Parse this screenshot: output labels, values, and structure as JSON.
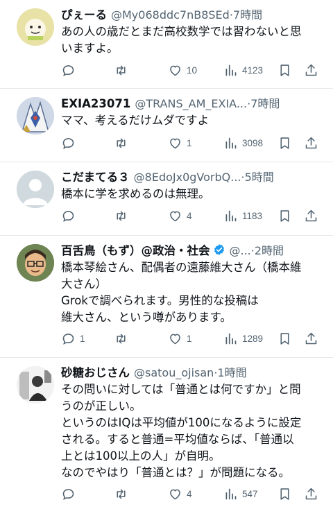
{
  "posts": [
    {
      "name": "ぴぇーる",
      "handle": "@My068ddc7nB8SEd",
      "sep": "·",
      "time": "7時間",
      "lines": [
        "あの人の歳だとまだ高校数学では習わないと思",
        "いますよ。"
      ],
      "replies": "",
      "reposts": "",
      "likes": "10",
      "views": "4123",
      "verified": false
    },
    {
      "name": "EXIA23071",
      "handle": "@TRANS_AM_EXIA...",
      "sep": "·",
      "time": "7時間",
      "lines": [
        "ママ、考えるだけムダですよ"
      ],
      "replies": "",
      "reposts": "",
      "likes": "1",
      "views": "3098",
      "verified": false
    },
    {
      "name": "こだまてる３",
      "handle": "@8EdoJx0gVorbQ...",
      "sep": "·",
      "time": "5時間",
      "lines": [
        "橋本に学を求めるのは無理。"
      ],
      "replies": "",
      "reposts": "",
      "likes": "4",
      "views": "1183",
      "verified": false
    },
    {
      "name": "百舌鳥（もず）@政治・社会",
      "handle": "@...",
      "sep": "·",
      "time": "2時間",
      "lines": [
        "橋本琴絵さん、配偶者の遠藤維大さん（橋本維",
        "大さん）",
        "Grokで調べられます。男性的な投稿は",
        "維大さん、という噂があります。"
      ],
      "replies": "1",
      "reposts": "",
      "likes": "1",
      "views": "1289",
      "verified": true
    },
    {
      "name": "砂糖おじさん",
      "handle": "@satou_ojisan",
      "sep": "·",
      "time": "1時間",
      "lines": [
        "その問いに対しては「普通とは何ですか」と問",
        "うのが正しい。",
        "というのはIQは平均値が100になるように設定",
        "される。すると普通=平均値ならば、「普通以",
        "上とは100以上の人」が自明。",
        "なのでやはり「普通とは？」が問題になる。"
      ],
      "replies": "",
      "reposts": "",
      "likes": "4",
      "views": "547",
      "verified": false
    }
  ],
  "colors": {
    "text": "#0f1419",
    "muted": "#536471",
    "verified": "#1d9bf0",
    "divider": "#e6e9eb"
  },
  "icons": {
    "reply": "reply-icon",
    "repost": "repost-icon",
    "like": "heart-icon",
    "views": "views-icon",
    "bookmark": "bookmark-icon",
    "share": "share-icon"
  }
}
